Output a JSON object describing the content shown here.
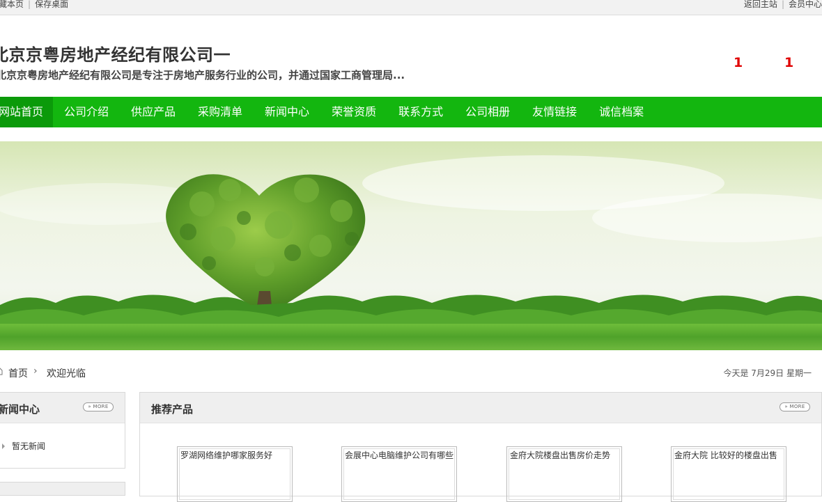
{
  "topbar": {
    "left_items": [
      "收藏本页",
      "保存桌面"
    ],
    "right_items": [
      "返回主站",
      "会员中心"
    ]
  },
  "header": {
    "company_name": "北京京粤房地产经纪有限公司一",
    "company_desc": "北京京粤房地产经纪有限公司是专注于房地产服务行业的公司，并通过国家工商管理局...",
    "num_1": "1",
    "num_2": "1"
  },
  "nav": {
    "items": [
      "网站首页",
      "公司介绍",
      "供应产品",
      "采购清单",
      "新闻中心",
      "荣誉资质",
      "联系方式",
      "公司相册",
      "友情链接",
      "诚信档案"
    ],
    "active_index": 0
  },
  "breadcrumb": {
    "home": "首页",
    "separator": "›",
    "current": "欢迎光临",
    "date_text": "今天是 7月29日 星期一"
  },
  "news": {
    "title": "新闻中心",
    "more": "» MORE",
    "empty_text": "暂无新闻"
  },
  "products": {
    "title": "推荐产品",
    "more": "» MORE",
    "items": [
      "罗湖网络维护哪家服务好",
      "会展中心电脑维护公司有哪些",
      "金府大院楼盘出售房价走势",
      "金府大院 比较好的楼盘出售"
    ]
  },
  "colors": {
    "nav_bg": "#13b60f",
    "nav_active": "#0b9a0a",
    "accent_red": "#e00000"
  }
}
